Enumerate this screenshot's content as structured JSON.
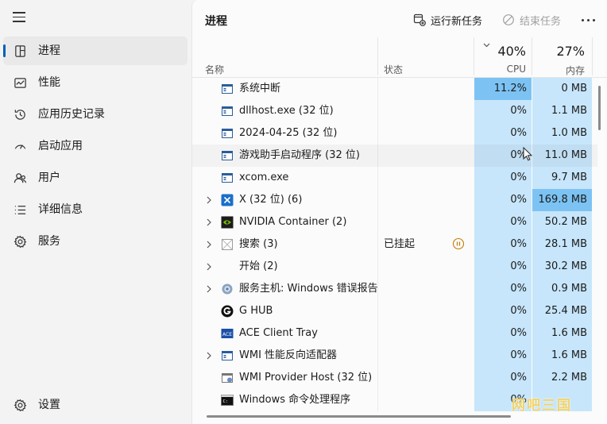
{
  "sidebar": {
    "items": [
      {
        "label": "进程",
        "icon": "processes-icon",
        "active": true
      },
      {
        "label": "性能",
        "icon": "performance-icon"
      },
      {
        "label": "应用历史记录",
        "icon": "app-history-icon"
      },
      {
        "label": "启动应用",
        "icon": "startup-icon"
      },
      {
        "label": "用户",
        "icon": "users-icon"
      },
      {
        "label": "详细信息",
        "icon": "details-icon"
      },
      {
        "label": "服务",
        "icon": "services-icon"
      }
    ],
    "settings_label": "设置"
  },
  "header": {
    "title": "进程",
    "run_task_label": "运行新任务",
    "end_task_label": "结束任务"
  },
  "table": {
    "columns": {
      "name": "名称",
      "status": "状态",
      "cpu_percent": "40%",
      "cpu_label": "CPU",
      "mem_percent": "27%",
      "mem_label": "内存"
    },
    "rows": [
      {
        "name": "系统中断",
        "status": "",
        "cpu": "11.2%",
        "mem": "0 MB",
        "expandable": false,
        "icon": "window-icon",
        "cpu_hot": true
      },
      {
        "name": "dllhost.exe (32 位)",
        "status": "",
        "cpu": "0%",
        "mem": "1.1 MB",
        "expandable": false,
        "icon": "window-icon"
      },
      {
        "name": "2024-04-25 (32 位)",
        "status": "",
        "cpu": "0%",
        "mem": "1.0 MB",
        "expandable": false,
        "icon": "window-icon"
      },
      {
        "name": "游戏助手启动程序 (32 位)",
        "status": "",
        "cpu": "0%",
        "mem": "11.0 MB",
        "expandable": false,
        "icon": "window-icon",
        "hover": true
      },
      {
        "name": "xcom.exe",
        "status": "",
        "cpu": "0%",
        "mem": "9.7 MB",
        "expandable": false,
        "icon": "window-icon"
      },
      {
        "name": "X (32 位) (6)",
        "status": "",
        "cpu": "0%",
        "mem": "169.8 MB",
        "expandable": true,
        "icon": "x-app-icon",
        "mem_hot": true
      },
      {
        "name": "NVIDIA Container (2)",
        "status": "",
        "cpu": "0%",
        "mem": "50.2 MB",
        "expandable": true,
        "icon": "nvidia-icon"
      },
      {
        "name": "搜索 (3)",
        "status": "已挂起",
        "cpu": "0%",
        "mem": "28.1 MB",
        "expandable": true,
        "icon": "search-app-icon",
        "paused": true
      },
      {
        "name": "开始 (2)",
        "status": "",
        "cpu": "0%",
        "mem": "30.2 MB",
        "expandable": true,
        "icon": "none"
      },
      {
        "name": "服务主机: Windows 错误报告",
        "status": "",
        "cpu": "0%",
        "mem": "0.9 MB",
        "expandable": true,
        "icon": "gear-icon"
      },
      {
        "name": "G HUB",
        "status": "",
        "cpu": "0%",
        "mem": "25.4 MB",
        "expandable": false,
        "icon": "ghub-icon"
      },
      {
        "name": "ACE Client Tray",
        "status": "",
        "cpu": "0%",
        "mem": "1.6 MB",
        "expandable": false,
        "icon": "ace-icon"
      },
      {
        "name": "WMI 性能反向适配器",
        "status": "",
        "cpu": "0%",
        "mem": "1.6 MB",
        "expandable": true,
        "icon": "window-icon"
      },
      {
        "name": "WMI Provider Host (32 位)",
        "status": "",
        "cpu": "0%",
        "mem": "2.2 MB",
        "expandable": false,
        "icon": "wmi-icon"
      },
      {
        "name": "Windows 命令处理程序",
        "status": "",
        "cpu": "0%",
        "mem": "",
        "expandable": false,
        "icon": "cmd-icon"
      }
    ]
  },
  "watermark": "网吧三国",
  "colors": {
    "accent": "#005fb8",
    "cpu_column": "#c7e6fb",
    "hot_cell": "#7cc3f3"
  }
}
